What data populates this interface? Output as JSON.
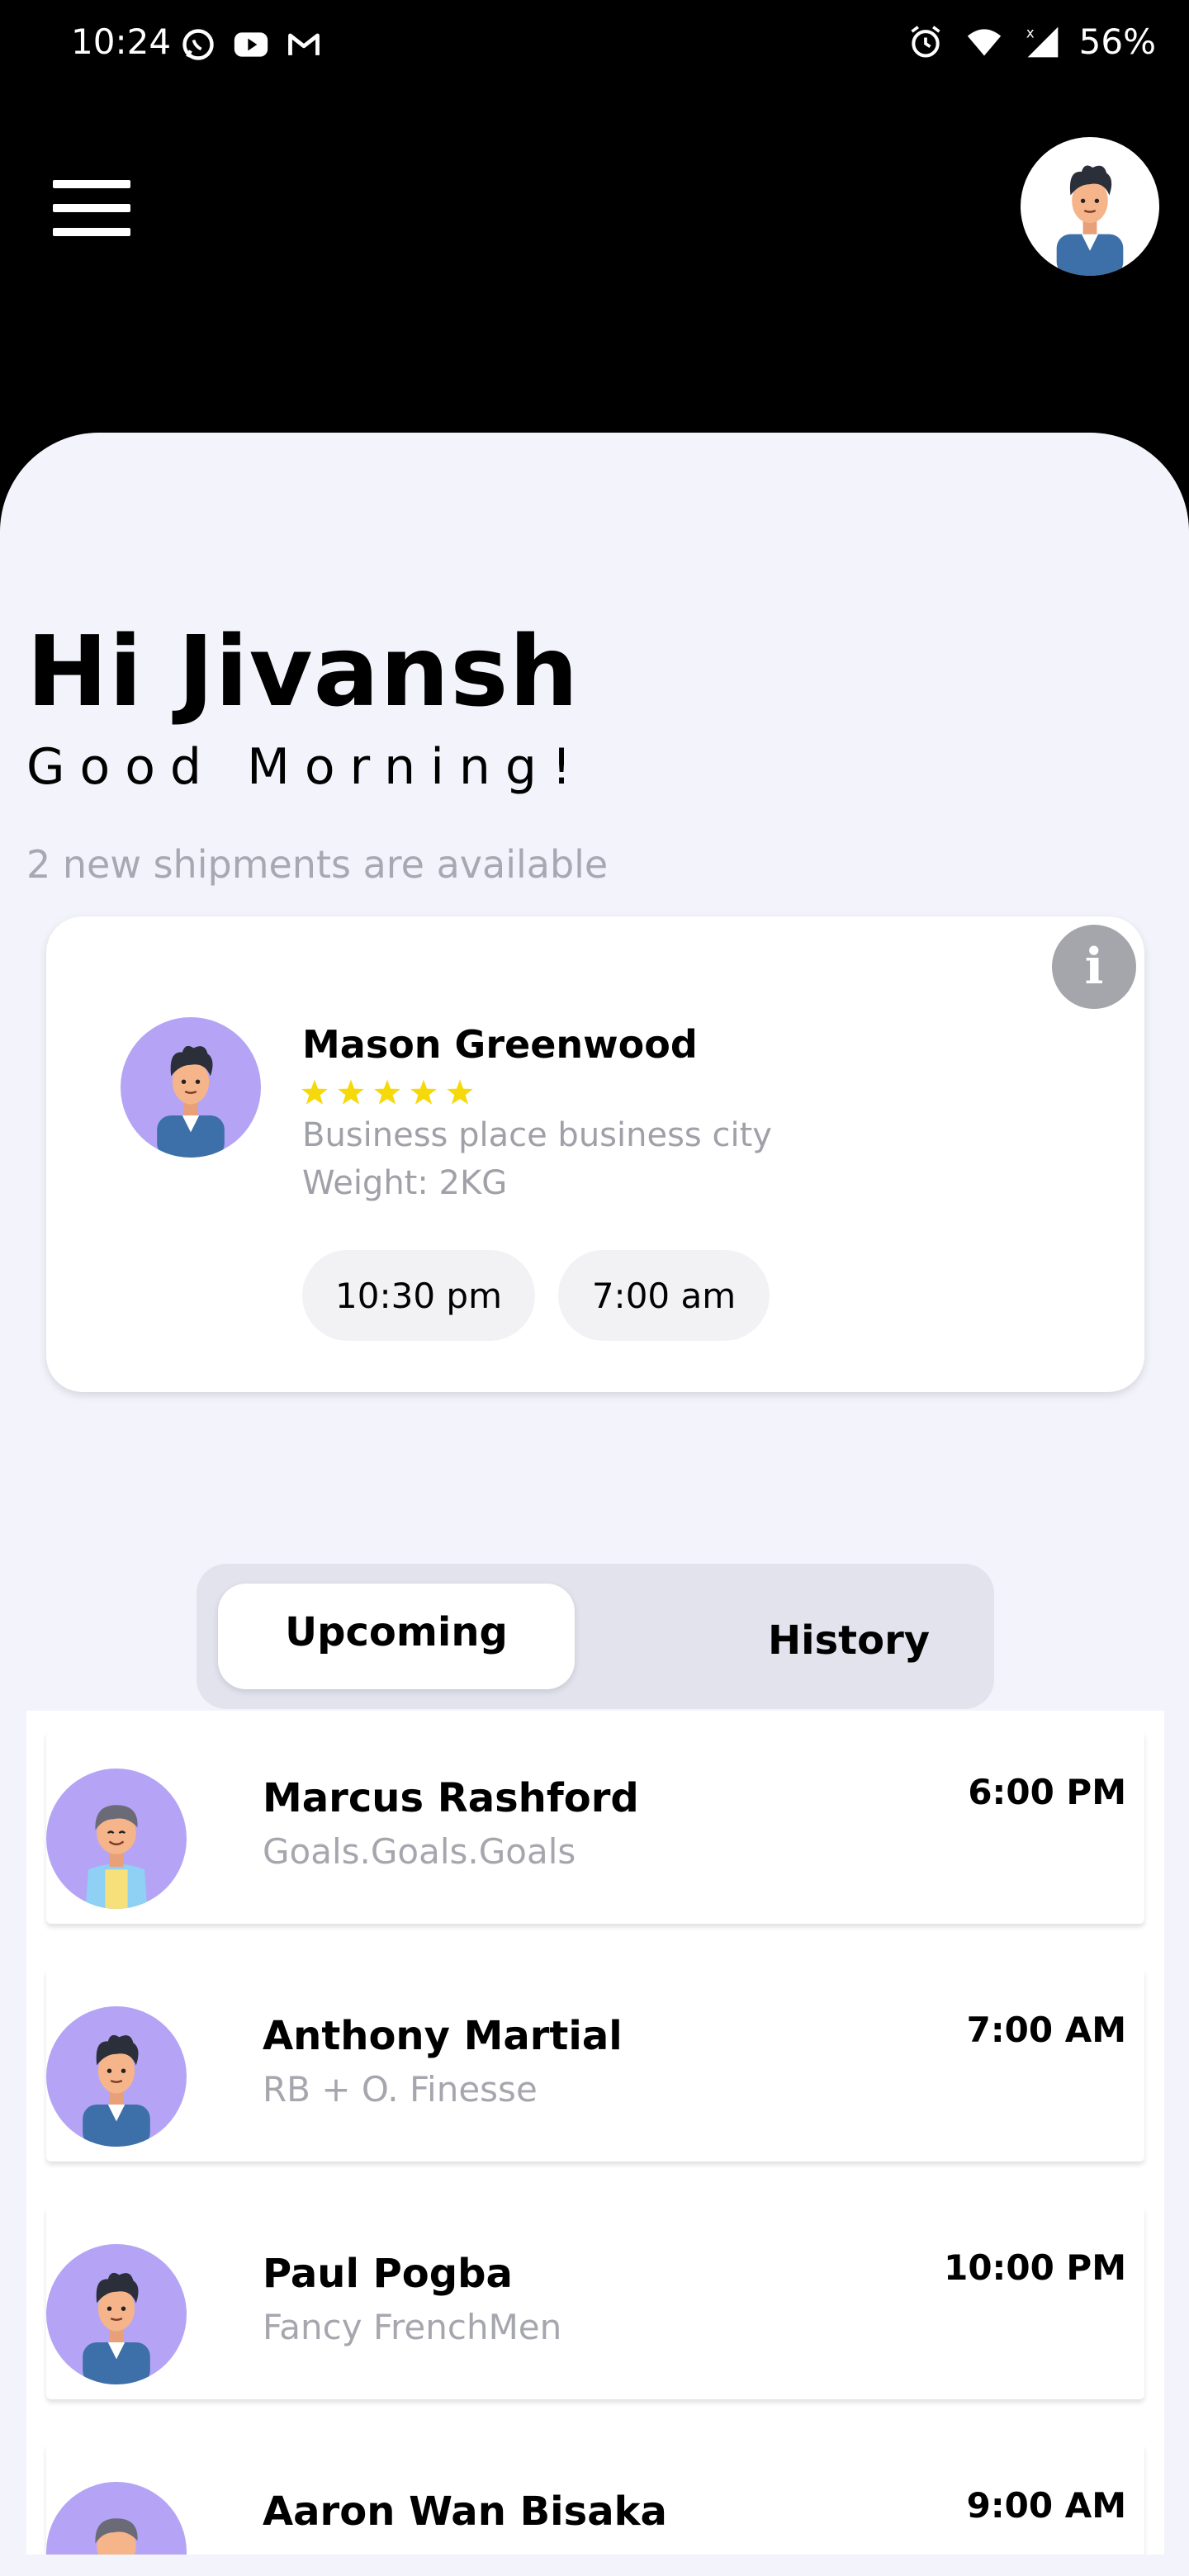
{
  "status_bar": {
    "time": "10:24",
    "left_icons": [
      "whatsapp-icon",
      "youtube-icon",
      "gmail-icon"
    ],
    "right_icons": [
      "alarm-icon",
      "wifi-icon",
      "signal-icon"
    ],
    "battery": "56%"
  },
  "header": {
    "menu_icon": "hamburger-menu-icon",
    "avatar": "user-avatar"
  },
  "greeting": {
    "title": "Hi Jivansh",
    "subtitle": "Good Morning!",
    "note": "2 new shipments are available"
  },
  "featured": {
    "name": "Mason Greenwood",
    "rating": 5,
    "address": "Business place business city",
    "weight": "Weight: 2KG",
    "pickup_time": "10:30 pm",
    "drop_time": "7:00 am",
    "info_label": "i"
  },
  "tabs": {
    "upcoming": "Upcoming",
    "history": "History",
    "active": "Upcoming"
  },
  "list": [
    {
      "name": "Marcus Rashford",
      "sub": "Goals.Goals.Goals",
      "time": "6:00 PM"
    },
    {
      "name": "Anthony Martial",
      "sub": "RB + O. Finesse",
      "time": "7:00 AM"
    },
    {
      "name": "Paul Pogba",
      "sub": "Fancy FrenchMen",
      "time": "10:00 PM"
    },
    {
      "name": "Aaron Wan Bisaka",
      "sub": "",
      "time": "9:00 AM"
    }
  ],
  "colors": {
    "background": "#000000",
    "sheet": "#f3f3fb",
    "avatar_bg": "#b5a4f5",
    "star": "#f5d90a",
    "muted_text": "#a6a6ae",
    "info_button": "#a4a6ab"
  }
}
